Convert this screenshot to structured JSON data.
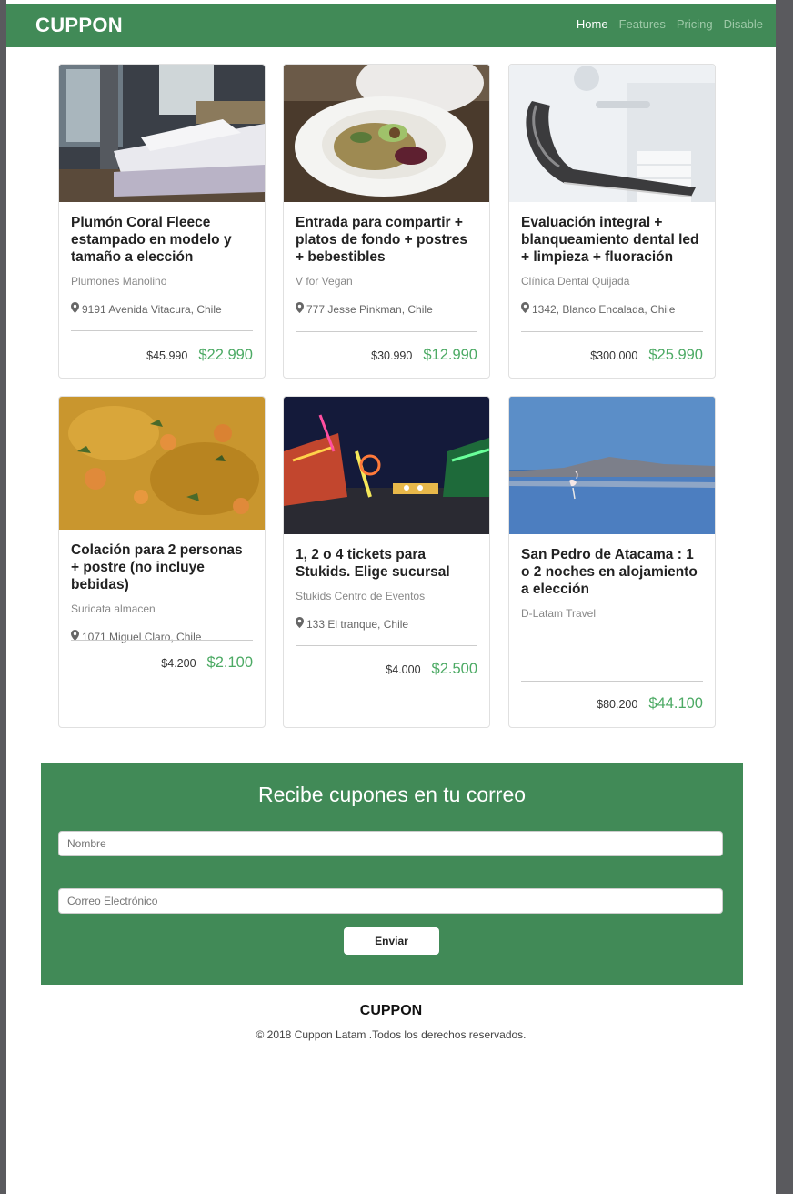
{
  "nav": {
    "brand": "CUPPON",
    "links": [
      "Home",
      "Features",
      "Pricing",
      "Disable"
    ]
  },
  "cards": [
    {
      "title": "Plumón Coral Fleece estampado en modelo y tamaño a elección",
      "vendor": "Plumones Manolino",
      "location": "9191 Avenida Vitacura, Chile",
      "old_price": "$45.990",
      "new_price": "$22.990",
      "image": "bedroom-photo"
    },
    {
      "title": "Entrada para compartir + platos de fondo + postres + bebestibles",
      "vendor": "V for Vegan",
      "location": "777 Jesse Pinkman, Chile",
      "old_price": "$30.990",
      "new_price": "$12.990",
      "image": "salad-plate-photo"
    },
    {
      "title": "Evaluación integral + blanqueamiento dental led + limpieza + fluoración",
      "vendor": "Clínica Dental Quijada",
      "location": "1342, Blanco Encalada, Chile",
      "old_price": "$300.000",
      "new_price": "$25.990",
      "image": "dental-chair-photo"
    },
    {
      "title": "Colación para 2 personas + postre (no incluye bebidas)",
      "vendor": "Suricata almacen",
      "location": "1071 Miguel Claro, Chile",
      "old_price": "$4.200",
      "new_price": "$2.100",
      "image": "food-dish-photo"
    },
    {
      "title": "1, 2 o 4 tickets para Stukids. Elige sucursal",
      "vendor": "Stukids Centro de Eventos",
      "location": "133 El tranque, Chile",
      "old_price": "$4.000",
      "new_price": "$2.500",
      "image": "fair-night-photo"
    },
    {
      "title": "San Pedro de Atacama : 1 o 2 noches en alojamiento a elección",
      "vendor": "D-Latam Travel",
      "location": "",
      "old_price": "$80.200",
      "new_price": "$44.100",
      "image": "lagoon-flamingo-photo"
    }
  ],
  "newsletter": {
    "title": "Recibe cupones en tu correo",
    "name_placeholder": "Nombre",
    "email_placeholder": "Correo Electrónico",
    "submit_label": "Enviar"
  },
  "footer": {
    "brand": "CUPPON",
    "copyright": "© 2018 Cuppon Latam .Todos los derechos reservados."
  },
  "colors": {
    "brand_green": "#418a57",
    "price_green": "#4caa64"
  }
}
